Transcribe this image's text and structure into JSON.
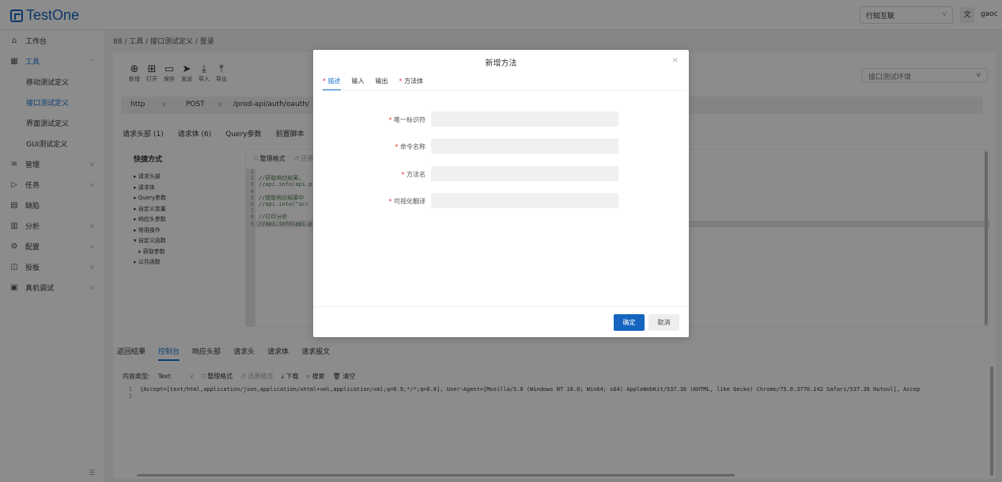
{
  "app": {
    "logo": "TestOne",
    "team": "行知互联",
    "lang": "文",
    "user": "gaoc"
  },
  "sidebar": {
    "items": [
      {
        "icon": "⌂",
        "label": "工作台",
        "chevron": ""
      },
      {
        "icon": "▦",
        "label": "工具",
        "chevron": "^"
      },
      {
        "icon": "",
        "label": "移动测试定义",
        "chevron": ""
      },
      {
        "icon": "",
        "label": "接口测试定义",
        "chevron": ""
      },
      {
        "icon": "",
        "label": "界面测试定义",
        "chevron": ""
      },
      {
        "icon": "",
        "label": "GUI测试定义",
        "chevron": ""
      },
      {
        "icon": "≡",
        "label": "管理",
        "chevron": "v"
      },
      {
        "icon": "▷",
        "label": "任务",
        "chevron": "v"
      },
      {
        "icon": "▤",
        "label": "缺陷",
        "chevron": ""
      },
      {
        "icon": "▥",
        "label": "分析",
        "chevron": "v"
      },
      {
        "icon": "⚙",
        "label": "配置",
        "chevron": "v"
      },
      {
        "icon": "◫",
        "label": "投板",
        "chevron": "v"
      },
      {
        "icon": "▣",
        "label": "真机调试",
        "chevron": "v"
      }
    ],
    "collapse": "☰"
  },
  "breadcrumb": "88 / 工具 / 接口测试定义 / 登录",
  "toolbar": [
    {
      "icon": "⊕",
      "label": "新增"
    },
    {
      "icon": "⊞",
      "label": "打开"
    },
    {
      "icon": "▭",
      "label": "保存"
    },
    {
      "icon": "➤",
      "label": "发送"
    },
    {
      "icon": "⤓",
      "label": "导入"
    },
    {
      "icon": "⤒",
      "label": "导出"
    }
  ],
  "env": {
    "placeholder": "接口测试环境",
    "chev": "v"
  },
  "request": {
    "protocol": "http",
    "method": "POST",
    "url": "/prod-api/auth/oauth/",
    "chev": "v"
  },
  "request_tabs": [
    "请求头部 (1)",
    "请求体 (6)",
    "Query参数",
    "前置脚本"
  ],
  "quick": {
    "title": "快捷方式",
    "items": [
      "▸ 请求头部",
      "▸ 请求体",
      "▸ Query参数",
      "▸ 自定义变量",
      "▸ 响应头参数",
      "▸ 常用操作",
      "▾ 自定义函数",
      "  ▸ 获取参数",
      "▸ 公共函数"
    ]
  },
  "editor": {
    "format": "∷ 整理格式",
    "restore": "↺ 还原",
    "lines": [
      {
        "n": "1",
        "t": ""
      },
      {
        "n": "2",
        "t": "//获取响应结果，"
      },
      {
        "n": "3",
        "t": "//api.info(api.p"
      },
      {
        "n": "4",
        "t": ""
      },
      {
        "n": "5",
        "t": "//提取响应结果中"
      },
      {
        "n": "6",
        "t": "//api.into(\"acc"
      },
      {
        "n": "7",
        "t": ""
      },
      {
        "n": "8",
        "t": "//打印分析"
      },
      {
        "n": "9",
        "t": "//api.info(api.p"
      }
    ]
  },
  "result_tabs": [
    "返回结果",
    "控制台",
    "响应头部",
    "请求头",
    "请求体",
    "请求报文"
  ],
  "console": {
    "type_label": "内容类型:",
    "type_value": "Text",
    "type_chev": "v",
    "format": "∷ 整理格式",
    "restore": "↺ 还原格式",
    "download": "⤓ 下载",
    "search": "⌕ 搜索",
    "clear": "🗑 清空",
    "lines": [
      {
        "n": "1",
        "t": "{Accept=[text/html,application/json,application/xhtml+xml,application/xml;q=0.9,*/*;q=0.8], User-Agent=[Mozilla/5.0 (Windows NT 10.0; Win64; x64) AppleWebKit/537.36 (KHTML, like Gecko) Chrome/75.0.3770.142 Safari/537.36 Hutool], Accep"
      },
      {
        "n": "2",
        "t": ""
      }
    ]
  },
  "modal": {
    "title": "新增方法",
    "close": "×",
    "tabs": [
      {
        "star": "*",
        "label": "描述"
      },
      {
        "star": "",
        "label": "输入"
      },
      {
        "star": "",
        "label": "输出"
      },
      {
        "star": "*",
        "label": "方法体"
      }
    ],
    "fields": [
      {
        "star": "*",
        "label": "唯一标识符"
      },
      {
        "star": "*",
        "label": "命令名称"
      },
      {
        "star": "*",
        "label": "方法名"
      },
      {
        "star": "*",
        "label": "可视化翻译"
      }
    ],
    "ok": "确定",
    "cancel": "取消"
  }
}
